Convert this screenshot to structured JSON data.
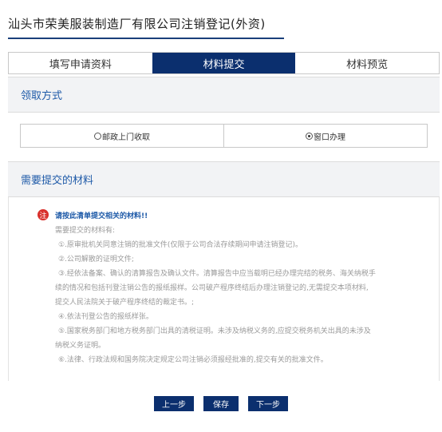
{
  "page": {
    "title": "汕头市荣美服装制造厂有限公司注销登记(外资)"
  },
  "tabs": [
    {
      "label": "填写申请资料",
      "active": false
    },
    {
      "label": "材料提交",
      "active": true
    },
    {
      "label": "材料预览",
      "active": false
    }
  ],
  "pickup": {
    "heading": "领取方式",
    "options": [
      {
        "label": "邮政上门收取",
        "checked": false
      },
      {
        "label": "窗口办理",
        "checked": true
      }
    ]
  },
  "materials": {
    "heading": "需要提交的材料",
    "notice_badge": "注",
    "notice": "请按此清单提交相关的材料!!",
    "items": [
      "需要提交的材料有:",
      "①.原审批机关同意注销的批准文件(仅限于公司合法存续期间申请注销登记)。",
      "②.公司解散的证明文件;",
      "③.经依法备案、确认的清算报告及确认文件。清算报告中应当载明已经办理完结的税务、海关纳税手",
      "续的情况和包括刊登注销公告的报纸报样。公司破产程序终结后办理注销登记的,无需提交本项材料,",
      "提交人民法院关于破产程序终结的裁定书。;",
      "④.依法刊登公告的报纸样张。",
      "⑤.国家税务部门和地方税务部门出具的清税证明。未涉及纳税义务的,应提交税务机关出具的未涉及",
      "纳税义务证明。",
      "⑥.法律、行政法规和国务院决定规定公司注销必须报经批准的,提交有关的批准文件。"
    ]
  },
  "buttons": {
    "prev": "上一步",
    "save": "保存",
    "next": "下一步"
  },
  "colors": {
    "accent": "#0b2f6e",
    "heading": "#1e5aa8",
    "notice_badge": "#d9302c"
  }
}
